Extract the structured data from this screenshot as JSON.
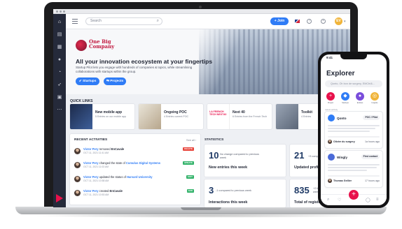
{
  "app": {
    "search_placeholder": "Search",
    "join_label": "+ Join",
    "avatar_initials": "EV"
  },
  "hero": {
    "brand_name": "One Big Company",
    "title": "All your innovation ecosystem at your fingertips",
    "subtitle": "Startup Pilot lets you engage with hundreds of companies & topics, while streamlining collaborations with startups within the group.",
    "btn_startups": "Startups",
    "btn_projects": "Projects"
  },
  "quick_links": {
    "title": "QUICK LINKS",
    "items": [
      {
        "title": "New mobile app",
        "desc": "5 Entries on our mobile app"
      },
      {
        "title": "Ongoing POC",
        "desc": "4 Entries current POC"
      },
      {
        "title": "Next 40",
        "desc": "6 Entries from the French Tech"
      },
      {
        "title": "Toolkit",
        "desc": "4 Entries"
      }
    ],
    "thumb_text": "LA FRENCH TECH NEXT40"
  },
  "activities": {
    "title": "RECENT ACTIVITIES",
    "see_all": "See all",
    "items": [
      {
        "text_user": "Victor Pery",
        "text_mid": " removed ",
        "text_obj": "EnCavale",
        "time": "OCT 11, 2021 11:41 AM",
        "tag": "DELETE",
        "tag_color": "#e8453c"
      },
      {
        "text_user": "Victor Pery",
        "text_mid": " changed the state of ",
        "text_obj": "Cumulus Digital Systems",
        "time": "OCT 11, 2021 11:03 AM",
        "tag": "UPDATE",
        "tag_color": "#34b36b"
      },
      {
        "text_user": "Victor Pery",
        "text_mid": " updated the status of ",
        "text_obj": "Harvard University",
        "time": "OCT 11, 2021 10:58 AM",
        "tag": "EDIT",
        "tag_color": "#34b36b"
      },
      {
        "text_user": "Victor Pery",
        "text_mid": " created ",
        "text_obj": "EnCavale",
        "time": "OCT 11, 2021 10:53 AM",
        "tag": "ADD",
        "tag_color": "#34b36b"
      }
    ]
  },
  "statistics": {
    "title": "STATISTICS",
    "cards": [
      {
        "value": "10",
        "delta": "No change compared to previous week",
        "label": "New entries this week"
      },
      {
        "value": "21",
        "delta": "+3 compared to previous week",
        "label": "Updated profiles this week"
      },
      {
        "value": "3",
        "delta": "-1 compared to previous week",
        "label": "Interactions this week"
      },
      {
        "value": "835",
        "delta": "+2 this week",
        "label": "Total of registered users"
      }
    ]
  },
  "phone": {
    "time": "9:41",
    "title": "Explorer",
    "search_placeholder": "Qonto, Oh bon de surgery, EMCtrl&...",
    "categories": [
      {
        "label": "Project",
        "color": "#e8114b",
        "glyph": "+"
      },
      {
        "label": "Startups",
        "color": "#2f7cf6",
        "glyph": "◆"
      },
      {
        "label": "Entities",
        "color": "#7a4ddb",
        "glyph": "●"
      },
      {
        "label": "Insights",
        "color": "#f0b43a",
        "glyph": "◎"
      }
    ],
    "feed_label": "Latest activity",
    "cards": [
      {
        "name": "Qonto",
        "pill": "POC / Pilot",
        "by": "Olivier du surgery",
        "ago": "1a hours ago",
        "logo": "#2f7cf6"
      },
      {
        "name": "Wingly",
        "pill": "First contact",
        "by": "Thomas Gellier",
        "ago": "17 hours ago",
        "logo": "#4b6bd8"
      }
    ]
  }
}
